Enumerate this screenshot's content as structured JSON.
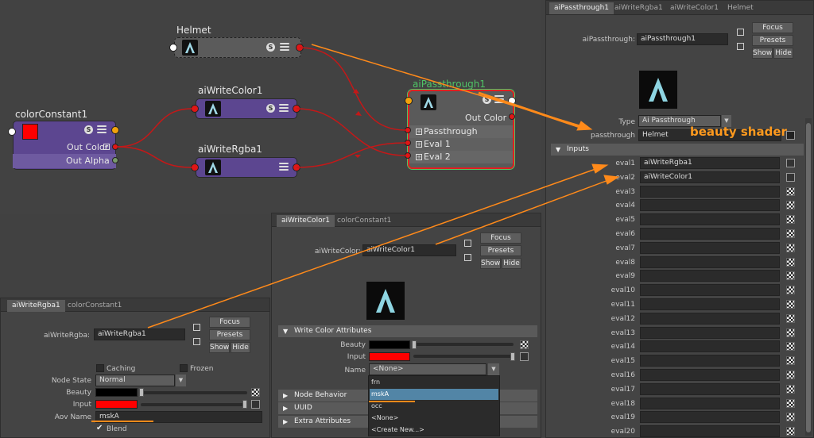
{
  "graph": {
    "helmet": {
      "title": "Helmet"
    },
    "colorconstant": {
      "title": "colorConstant1",
      "rows": [
        "Out Color",
        "Out Alpha"
      ],
      "color": "#ff0000"
    },
    "writecolor": {
      "title": "aiWriteColor1"
    },
    "writergba": {
      "title": "aiWriteRgba1"
    },
    "passthrough": {
      "title": "aiPassthrough1",
      "out": "Out Color",
      "rows": [
        "Passthrough",
        "Eval 1",
        "Eval 2"
      ]
    }
  },
  "colors": {
    "node_purple": "#5c4690",
    "node_gray": "#5a5a5a",
    "wire": "#c41818",
    "annotation": "#ff8a1a",
    "selected": "#4fc466"
  },
  "annotation": {
    "text": "beauty shader"
  },
  "passthrough_panel": {
    "tabs": [
      "aiPassthrough1",
      "aiWriteRgba1",
      "aiWriteColor1",
      "Helmet"
    ],
    "name_label": "aiPassthrough:",
    "name_value": "aiPassthrough1",
    "buttons": {
      "focus": "Focus",
      "presets": "Presets",
      "show": "Show",
      "hide": "Hide"
    },
    "type_label": "Type",
    "type_value": "Ai Passthrough",
    "passthrough_label": "passthrough",
    "passthrough_value": "Helmet",
    "inputs_section": "Inputs",
    "evals": [
      {
        "label": "eval1",
        "value": "aiWriteRgba1"
      },
      {
        "label": "eval2",
        "value": "aiWriteColor1"
      },
      {
        "label": "eval3",
        "value": ""
      },
      {
        "label": "eval4",
        "value": ""
      },
      {
        "label": "eval5",
        "value": ""
      },
      {
        "label": "eval6",
        "value": ""
      },
      {
        "label": "eval7",
        "value": ""
      },
      {
        "label": "eval8",
        "value": ""
      },
      {
        "label": "eval9",
        "value": ""
      },
      {
        "label": "eval10",
        "value": ""
      },
      {
        "label": "eval11",
        "value": ""
      },
      {
        "label": "eval12",
        "value": ""
      },
      {
        "label": "eval13",
        "value": ""
      },
      {
        "label": "eval14",
        "value": ""
      },
      {
        "label": "eval15",
        "value": ""
      },
      {
        "label": "eval16",
        "value": ""
      },
      {
        "label": "eval17",
        "value": ""
      },
      {
        "label": "eval18",
        "value": ""
      },
      {
        "label": "eval19",
        "value": ""
      },
      {
        "label": "eval20",
        "value": ""
      }
    ]
  },
  "writecolor_panel": {
    "tabs": [
      "aiWriteColor1",
      "colorConstant1"
    ],
    "name_label": "aiWriteColor:",
    "name_value": "aiWriteColor1",
    "buttons": {
      "focus": "Focus",
      "presets": "Presets",
      "show": "Show",
      "hide": "Hide"
    },
    "section_write": "Write Color Attributes",
    "beauty_label": "Beauty",
    "input_label": "Input",
    "name_attr_label": "Name",
    "name_attr_value": "<None>",
    "dropdown_items": [
      "frn",
      "mskA",
      "occ",
      "<None>",
      "<Create New...>"
    ],
    "dropdown_selected": "mskA",
    "sections": [
      "Node Behavior",
      "UUID",
      "Extra Attributes"
    ]
  },
  "writergba_panel": {
    "tabs": [
      "aiWriteRgba1",
      "colorConstant1"
    ],
    "name_label": "aiWriteRgba:",
    "name_value": "aiWriteRgba1",
    "buttons": {
      "focus": "Focus",
      "presets": "Presets",
      "show": "Show",
      "hide": "Hide"
    },
    "caching_label": "Caching",
    "frozen_label": "Frozen",
    "node_state_label": "Node State",
    "node_state_value": "Normal",
    "beauty_label": "Beauty",
    "input_label": "Input",
    "aov_label": "Aov Name",
    "aov_value": "mskA",
    "blend_label": "Blend"
  }
}
